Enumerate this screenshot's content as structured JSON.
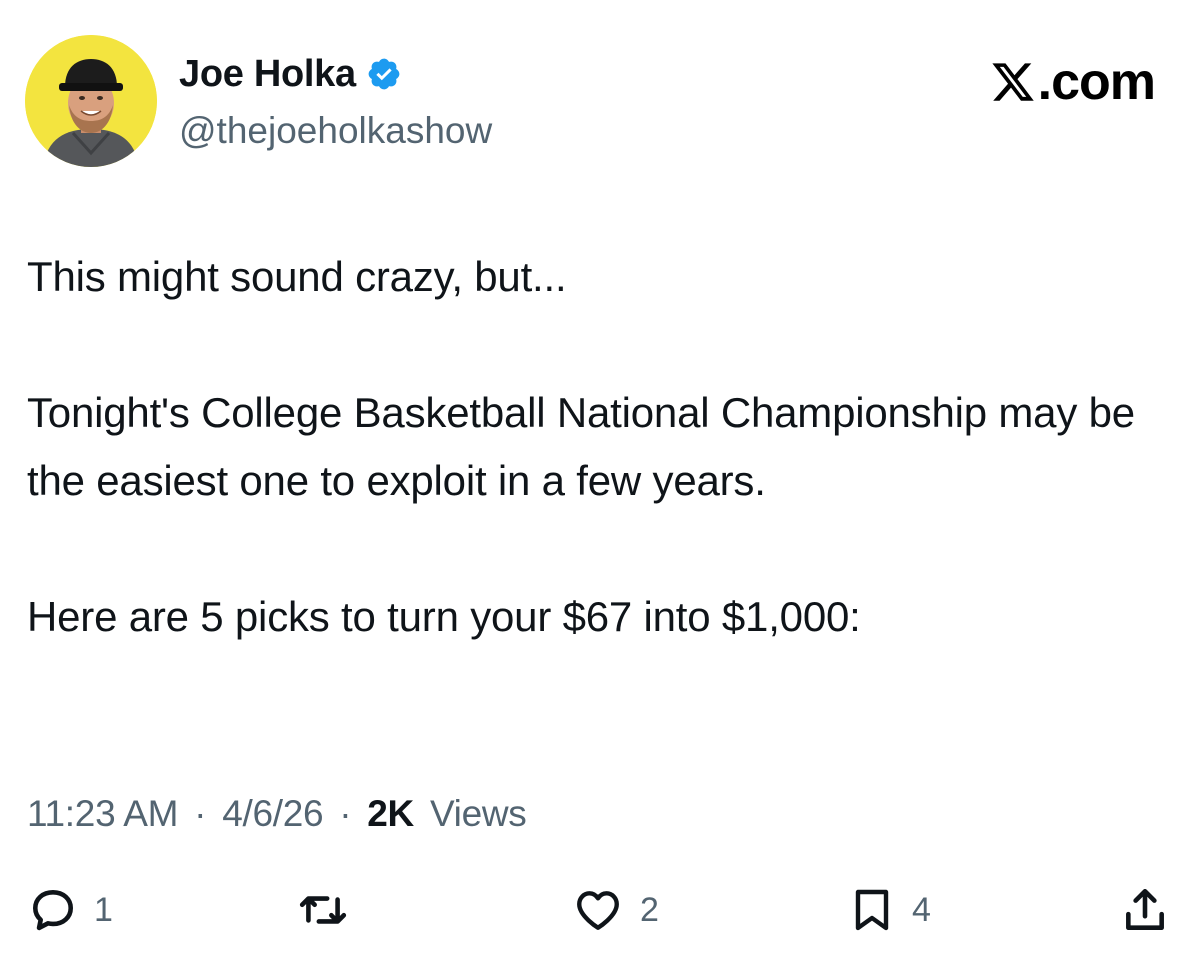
{
  "author": {
    "display_name": "Joe Holka",
    "handle": "@thejoeholkashow",
    "verified": true,
    "avatar_bg": "#f3e43f",
    "verified_color": "#1d9bf0"
  },
  "brand": {
    "logo_text": ".com",
    "logo_icon": "x-logo-icon"
  },
  "tweet": {
    "paragraphs": [
      "This might sound crazy, but...",
      "Tonight's College Basketball National Championship may be the easiest one to exploit in a few years.",
      "Here are 5 picks to turn your $67 into $1,000:"
    ],
    "time": "11:23 AM",
    "date": "4/6/26",
    "separator": "·",
    "views_count": "2K",
    "views_label": "Views"
  },
  "actions": {
    "reply": {
      "icon": "reply-icon",
      "count": "1"
    },
    "repost": {
      "icon": "repost-icon",
      "count": ""
    },
    "like": {
      "icon": "heart-icon",
      "count": "2"
    },
    "bookmark": {
      "icon": "bookmark-icon",
      "count": "4"
    },
    "share": {
      "icon": "share-icon",
      "count": ""
    }
  }
}
